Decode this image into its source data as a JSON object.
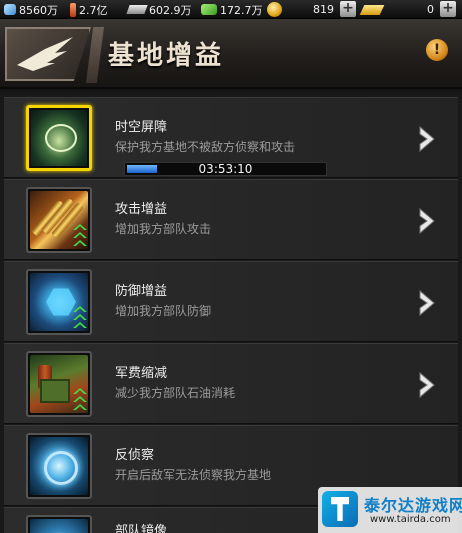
{
  "resources": [
    {
      "icon": "crystal-icon",
      "value": "8560万"
    },
    {
      "icon": "oil-icon",
      "value": "2.7亿"
    },
    {
      "icon": "steel-icon",
      "value": "602.9万"
    },
    {
      "icon": "money-icon",
      "value": "172.7万"
    },
    {
      "icon": "coin-icon",
      "value": "819"
    },
    {
      "icon": "gold-bar-icon",
      "value": "0"
    }
  ],
  "header": {
    "title": "基地增益",
    "emblem_icon": "eagle-emblem-icon",
    "info_icon": "exclamation-icon",
    "info_symbol": "!"
  },
  "items": [
    {
      "name": "时空屏障",
      "desc": "保护我方基地不被敌方侦察和攻击",
      "icon": "base-shield-icon",
      "selected": true,
      "has_upgrade": false,
      "timer": "03:53:10",
      "progress": 0.15
    },
    {
      "name": "攻击增益",
      "desc": "增加我方部队攻击",
      "icon": "bullets-icon",
      "has_upgrade": true
    },
    {
      "name": "防御增益",
      "desc": "增加我方部队防御",
      "icon": "hex-shield-icon",
      "has_upgrade": true
    },
    {
      "name": "军费缩减",
      "desc": "减少我方部队石油消耗",
      "icon": "supply-crates-icon",
      "has_upgrade": true
    },
    {
      "name": "反侦察",
      "desc": "开启后敌军无法侦察我方基地",
      "icon": "radar-ring-icon",
      "has_upgrade": false
    },
    {
      "name": "部队镜像",
      "desc": "",
      "icon": "mirror-icon",
      "has_upgrade": false
    }
  ],
  "watermark": {
    "text": "泰尔达游戏网",
    "url": "www.tairda.com"
  },
  "colors": {
    "accent_selected": "#f5d400",
    "progress": "#2d7be0",
    "upgrade_chevron": "#47d64a"
  }
}
